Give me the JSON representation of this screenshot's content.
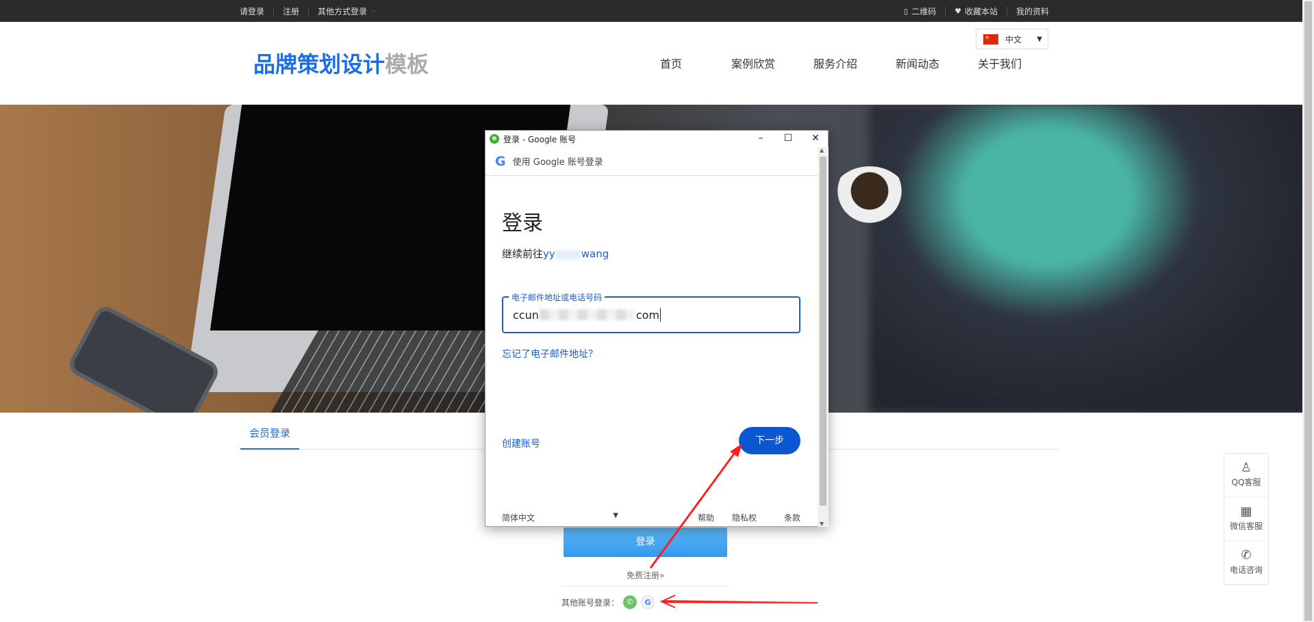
{
  "topbar": {
    "login": "请登录",
    "register": "注册",
    "other_login": "其他方式登录",
    "qrcode": "二维码",
    "favorite": "收藏本站",
    "profile": "我的资料"
  },
  "header": {
    "logo_blue": "品牌策划设计",
    "logo_gray": "模板",
    "language": "中文",
    "nav": [
      "首页",
      "案例欣赏",
      "服务介绍",
      "新闻动态",
      "关于我们"
    ]
  },
  "member": {
    "tab": "会员登录",
    "login_button": "登录",
    "free_register": "免费注册»",
    "other_accounts": "其他账号登录："
  },
  "side_service": [
    "QQ客服",
    "微信客服",
    "电话咨询"
  ],
  "popup": {
    "window_title": "登录 - Google 账号",
    "google_bar": "使用 Google 账号登录",
    "heading": "登录",
    "continue_prefix": "继续前往",
    "continue_app_start": "yy",
    "continue_app_end": "wang",
    "field_label": "电子邮件地址或电话号码",
    "field_value_start": "ccun",
    "field_value_end": "com",
    "forgot_email": "忘记了电子邮件地址？",
    "create_account": "创建账号",
    "next_button": "下一步",
    "footer_language": "简体中文",
    "footer_help": "帮助",
    "footer_privacy": "隐私权",
    "footer_terms": "条款"
  },
  "colors": {
    "brand_blue": "#1a6fe8",
    "google_blue": "#0b57d0",
    "annotation_red": "#ff1f1f"
  }
}
